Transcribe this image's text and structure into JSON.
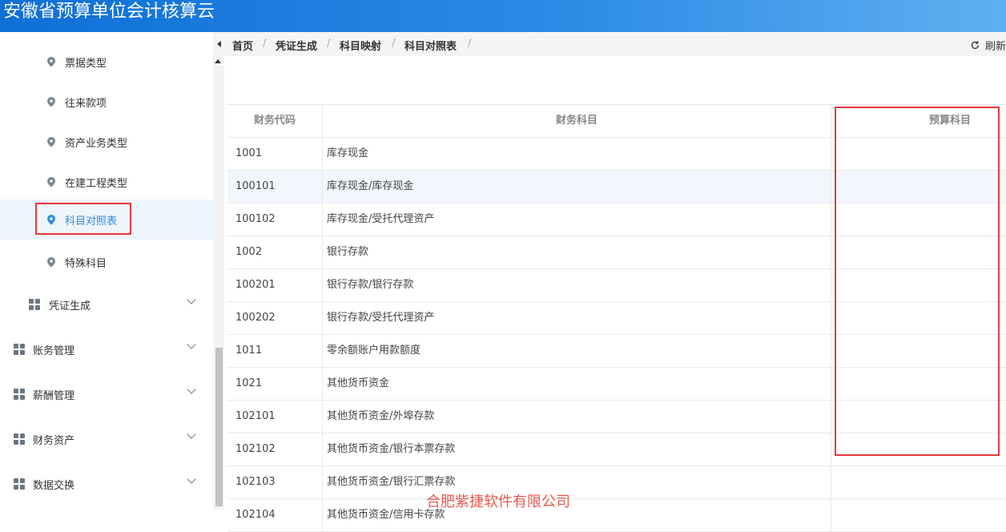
{
  "app": {
    "title": "安徽省预算单位会计核算云"
  },
  "breadcrumb": {
    "items": [
      "首页",
      "凭证生成",
      "科目映射",
      "科目对照表"
    ],
    "refresh_label": "刷新"
  },
  "sidebar": {
    "sub_items": [
      {
        "label": "票据类型",
        "active": false
      },
      {
        "label": "往来款项",
        "active": false
      },
      {
        "label": "资产业务类型",
        "active": false
      },
      {
        "label": "在建工程类型",
        "active": false
      },
      {
        "label": "科目对照表",
        "active": true
      },
      {
        "label": "特殊科目",
        "active": false
      }
    ],
    "groups": [
      {
        "label": "凭证生成"
      },
      {
        "label": "账务管理"
      },
      {
        "label": "薪酬管理"
      },
      {
        "label": "财务资产"
      },
      {
        "label": "数据交换"
      }
    ]
  },
  "table": {
    "columns": [
      "财务代码",
      "财务科目",
      "预算科目"
    ],
    "rows": [
      {
        "code": "1001",
        "account": "库存现金",
        "budget": ""
      },
      {
        "code": "100101",
        "account": "库存现金/库存现金",
        "budget": ""
      },
      {
        "code": "100102",
        "account": "库存现金/受托代理资产",
        "budget": ""
      },
      {
        "code": "1002",
        "account": "银行存款",
        "budget": ""
      },
      {
        "code": "100201",
        "account": "银行存款/银行存款",
        "budget": ""
      },
      {
        "code": "100202",
        "account": "银行存款/受托代理资产",
        "budget": ""
      },
      {
        "code": "1011",
        "account": "零余额账户用款额度",
        "budget": ""
      },
      {
        "code": "1021",
        "account": "其他货币资金",
        "budget": ""
      },
      {
        "code": "102101",
        "account": "其他货币资金/外埠存款",
        "budget": ""
      },
      {
        "code": "102102",
        "account": "其他货币资金/银行本票存款",
        "budget": ""
      },
      {
        "code": "102103",
        "account": "其他货币资金/银行汇票存款",
        "budget": ""
      },
      {
        "code": "102104",
        "account": "其他货币资金/信用卡存款",
        "budget": ""
      }
    ],
    "highlighted_row_index": 1
  },
  "watermark": "合肥紫捷软件有限公司",
  "colors": {
    "accent": "#2b8de3",
    "topbar": "#0e6fd6",
    "annotation": "#e8383d"
  },
  "icons": {
    "sub_item": "location-pin-icon",
    "group": "grid-icon",
    "group_toggle": "chevron-down-icon",
    "refresh": "refresh-icon",
    "sidebar_toggle": "caret-left-icon"
  }
}
